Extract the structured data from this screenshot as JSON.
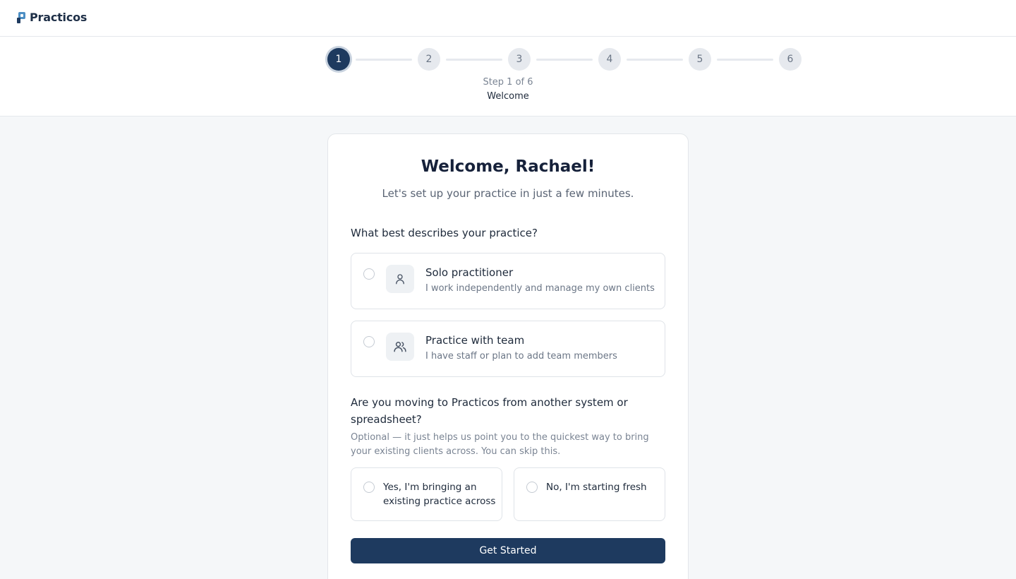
{
  "brand": {
    "name": "Practicos"
  },
  "stepper": {
    "steps": [
      "1",
      "2",
      "3",
      "4",
      "5",
      "6"
    ],
    "active_index": 0,
    "caption": "Step 1 of 6",
    "current_name": "Welcome"
  },
  "card": {
    "title": "Welcome, Rachael!",
    "subtitle": "Let's set up your practice in just a few minutes.",
    "practice_question": "What best describes your practice?",
    "practice_options": [
      {
        "title": "Solo practitioner",
        "description": "I work independently and manage my own clients",
        "icon": "user-icon",
        "selected": false
      },
      {
        "title": "Practice with team",
        "description": "I have staff or plan to add team members",
        "icon": "users-icon",
        "selected": false
      }
    ],
    "migration_question": "Are you moving to Practicos from another system or spreadsheet?",
    "migration_help": "Optional — it just helps us point you to the quickest way to bring your existing clients across. You can skip this.",
    "migration_options": [
      {
        "label": "Yes, I'm bringing an existing practice across",
        "selected": false
      },
      {
        "label": "No, I'm starting fresh",
        "selected": false
      }
    ],
    "cta_label": "Get Started"
  },
  "colors": {
    "primary": "#1e3a5f",
    "background": "#f5f7f9",
    "border": "#dfe3e8"
  }
}
